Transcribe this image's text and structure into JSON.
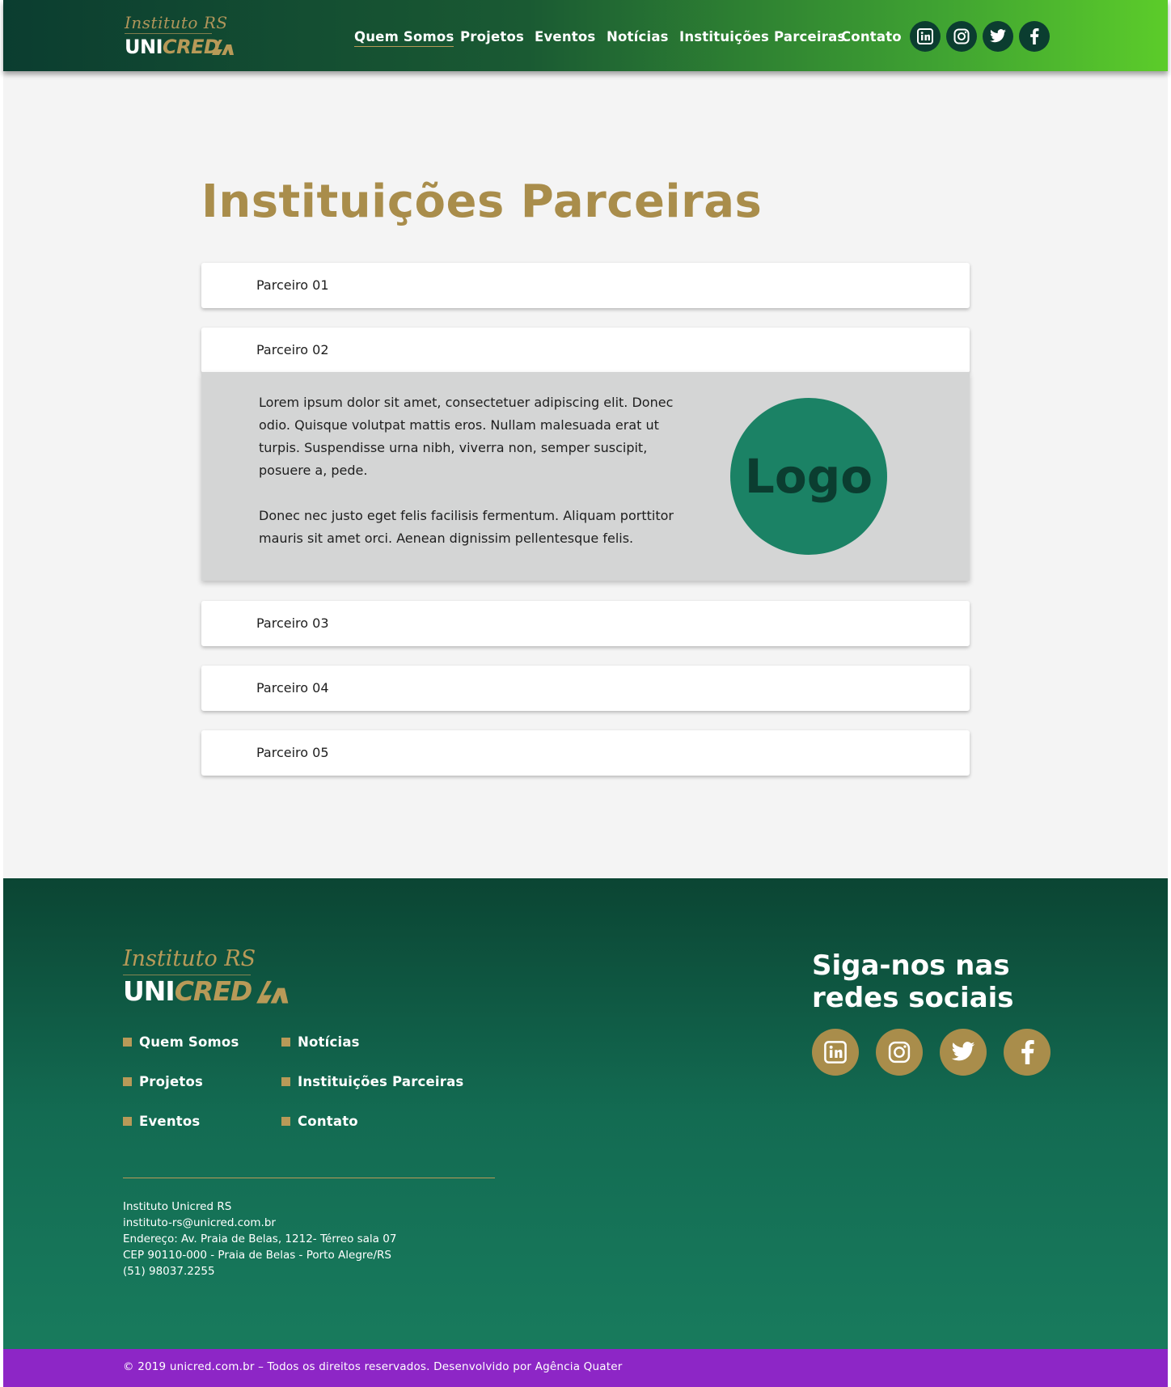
{
  "header": {
    "brand": {
      "script": "Instituto RS",
      "uni": "UNI",
      "cred": "CRED"
    },
    "nav": [
      {
        "label": "Quem Somos",
        "active": true
      },
      {
        "label": "Projetos"
      },
      {
        "label": "Eventos"
      },
      {
        "label": "Notícias"
      },
      {
        "label": "Instituições Parceiras"
      },
      {
        "label": "Contato"
      }
    ],
    "social_icons": [
      "linkedin-icon",
      "instagram-icon",
      "twitter-icon",
      "facebook-icon"
    ]
  },
  "main": {
    "title": "Instituições Parceiras",
    "partners": [
      {
        "label": "Parceiro 01"
      },
      {
        "label": "Parceiro 02",
        "expanded": true
      },
      {
        "label": "Parceiro 03"
      },
      {
        "label": "Parceiro 04"
      },
      {
        "label": "Parceiro 05"
      }
    ],
    "expanded_panel": {
      "paragraph1": "Lorem ipsum dolor sit amet, consectetuer adipiscing elit. Donec odio. Quisque volutpat mattis eros. Nullam malesuada erat ut turpis. Suspendisse urna nibh, viverra non, semper suscipit, posuere a, pede.",
      "paragraph2": "Donec nec justo eget felis facilisis fermentum. Aliquam porttitor mauris sit amet orci. Aenean dignissim pellentesque felis.",
      "logo_text": "Logo"
    }
  },
  "footer": {
    "brand": {
      "script": "Instituto RS",
      "uni": "UNI",
      "cred": "CRED"
    },
    "links_col1": [
      "Quem Somos",
      "Projetos",
      "Eventos"
    ],
    "links_col2": [
      "Notícias",
      "Instituições Parceiras",
      "Contato"
    ],
    "contact": {
      "name": "Instituto Unicred RS",
      "email": "instituto-rs@unicred.com.br",
      "address": "Endereço: Av. Praia de Belas, 1212- Térreo sala 07",
      "cep": "CEP 90110-000 - Praia de Belas - Porto Alegre/RS",
      "phone": "(51) 98037.2255"
    },
    "follow_title": "Siga-nos nas redes sociais",
    "social_icons": [
      "linkedin-icon",
      "instagram-icon",
      "twitter-icon",
      "facebook-icon"
    ],
    "copyright": "© 2019 unicred.com.br – Todos os direitos reservados. Desenvolvido por Agência Quater"
  },
  "colors": {
    "gold": "#a98d4b",
    "dark_green": "#0b3d30",
    "bright_green": "#5ccc2a",
    "logo_green": "#1b8265",
    "purple": "#8d26c6",
    "panel_gray": "#d4d5d5",
    "page_bg": "#f4f4f4"
  }
}
